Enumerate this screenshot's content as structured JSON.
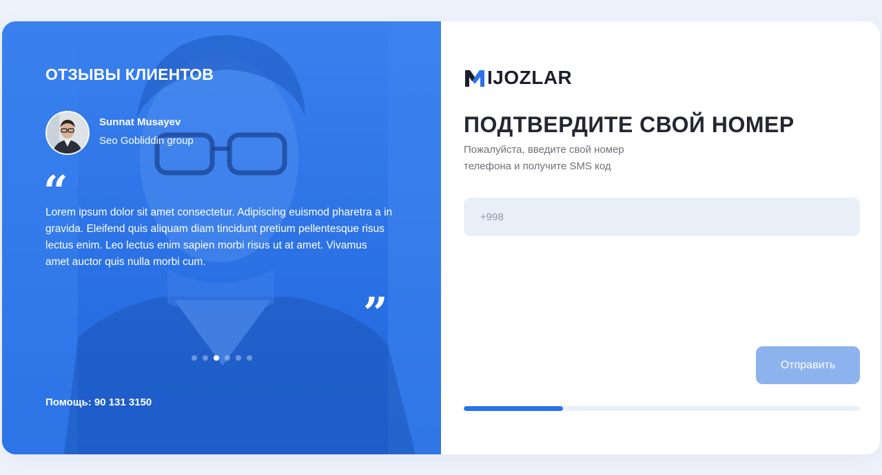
{
  "testimonials": {
    "title": "ОТЗЫВЫ КЛИЕНТОВ",
    "reviewer": {
      "name": "Sunnat Musayev",
      "company": "Seo Gobliddin group",
      "avatar_icon": "person-photo"
    },
    "quote_open": "“",
    "quote_close": "”",
    "text": "Lorem ipsum dolor sit amet consectetur. Adipiscing euismod pharetra a in gravida. Eleifend quis aliquam diam tincidunt pretium pellentesque risus lectus enim. Leo lectus enim sapien morbi risus ut at amet. Vivamus amet auctor quis nulla morbi cum.",
    "slider": {
      "count": 6,
      "active_index": 2
    },
    "help": "Помощь: 90 131 3150"
  },
  "form": {
    "logo_text": "IJOZLAR",
    "heading": "ПОДТВЕРДИТЕ СВОЙ НОМЕР",
    "subtitle_lines": [
      "Пожалуйста, введите свой номер",
      "телефона и получите SMS код"
    ],
    "phone": {
      "value": "",
      "placeholder": "+998"
    },
    "submit_label": "Отправить",
    "progress": 0.25
  },
  "colors": {
    "accent": "#2a73e8",
    "button_disabled": "#8db3ef",
    "input_bg": "#e8eff9",
    "heading": "#25262f"
  }
}
